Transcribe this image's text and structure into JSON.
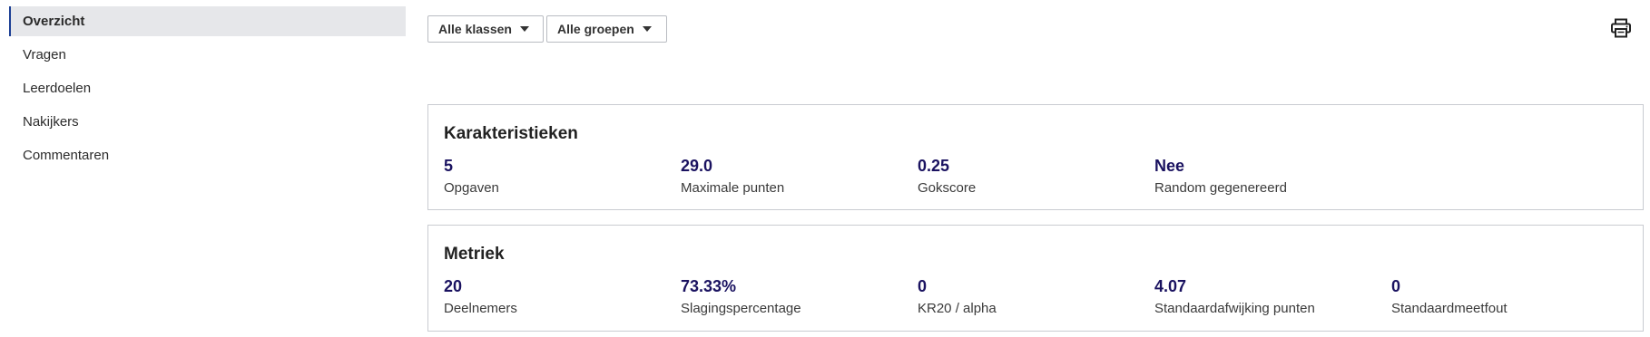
{
  "sidebar": {
    "items": [
      {
        "label": "Overzicht",
        "active": true
      },
      {
        "label": "Vragen",
        "active": false
      },
      {
        "label": "Leerdoelen",
        "active": false
      },
      {
        "label": "Nakijkers",
        "active": false
      },
      {
        "label": "Commentaren",
        "active": false
      }
    ]
  },
  "filters": {
    "classes_label": "Alle klassen",
    "groups_label": "Alle groepen"
  },
  "toolbar": {
    "print_icon": "printer-icon"
  },
  "characteristics": {
    "title": "Karakteristieken",
    "stats": [
      {
        "value": "5",
        "label": "Opgaven"
      },
      {
        "value": "29.0",
        "label": "Maximale punten"
      },
      {
        "value": "0.25",
        "label": "Gokscore"
      },
      {
        "value": "Nee",
        "label": "Random gegenereerd"
      }
    ]
  },
  "metrics": {
    "title": "Metriek",
    "stats": [
      {
        "value": "20",
        "label": "Deelnemers"
      },
      {
        "value": "73.33%",
        "label": "Slagingspercentage"
      },
      {
        "value": "0",
        "label": "KR20 / alpha"
      },
      {
        "value": "4.07",
        "label": "Standaardafwijking punten"
      },
      {
        "value": "0",
        "label": "Standaardmeetfout"
      }
    ]
  },
  "colors": {
    "accent": "#1c3f94",
    "value_text": "#1a1260",
    "active_bg": "#e6e7ea"
  }
}
